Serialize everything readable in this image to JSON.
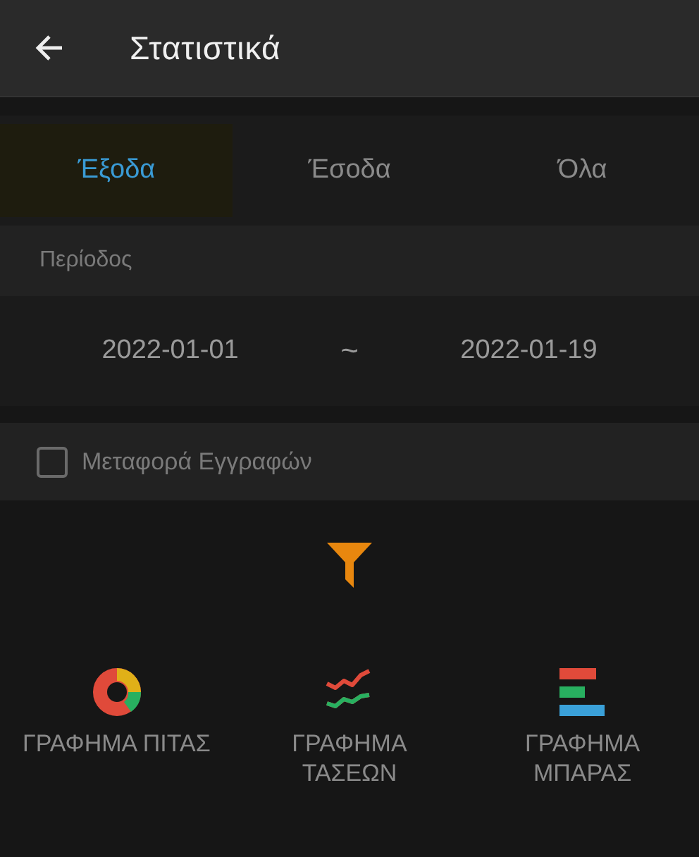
{
  "header": {
    "title": "Στατιστικά"
  },
  "tabs": [
    {
      "label": "Έξοδα",
      "selected": true
    },
    {
      "label": "Έσοδα",
      "selected": false
    },
    {
      "label": "Όλα",
      "selected": false
    }
  ],
  "period": {
    "label": "Περίοδος",
    "start": "2022-01-01",
    "separator": "~",
    "end": "2022-01-19"
  },
  "transfer": {
    "label": "Μεταφορά Εγγραφών",
    "checked": false
  },
  "charts": [
    {
      "kind": "pie",
      "label": "ΓΡΑΦΗΜΑ ΠΙΤΑΣ"
    },
    {
      "kind": "trend",
      "label": "ΓΡΑΦΗΜΑ ΤΑΣΕΩΝ"
    },
    {
      "kind": "bar",
      "label": "ΓΡΑΦΗΜΑ ΜΠΑΡΑΣ"
    }
  ]
}
